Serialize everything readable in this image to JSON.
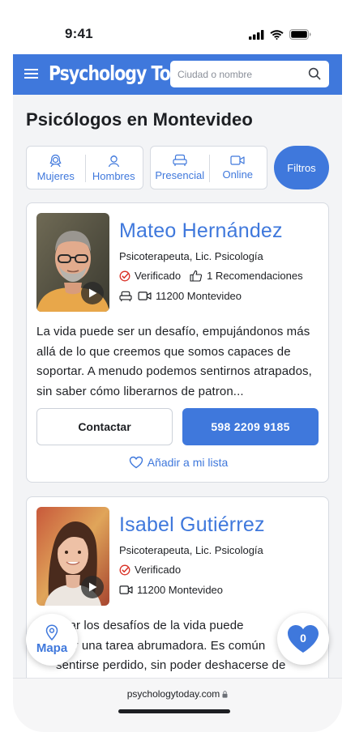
{
  "status_bar": {
    "time": "9:41"
  },
  "header": {
    "brand": "Psychology Today",
    "search_placeholder": "Ciudad o nombre"
  },
  "page": {
    "title": "Psicólogos en Montevideo"
  },
  "filters": {
    "gender": [
      {
        "label": "Mujeres",
        "icon": "woman-icon"
      },
      {
        "label": "Hombres",
        "icon": "man-icon"
      }
    ],
    "mode": [
      {
        "label": "Presencial",
        "icon": "armchair-icon"
      },
      {
        "label": "Online",
        "icon": "video-icon"
      }
    ],
    "filters_button": "Filtros"
  },
  "therapists": [
    {
      "name": "Mateo Hernández",
      "credentials": "Psicoterapeuta, Lic. Psicología",
      "verified": "Verificado",
      "recommendations": "1 Recomendaciones",
      "location": "11200 Montevideo",
      "bio": "La vida puede ser un desafío, empujándonos más allá de lo que creemos que somos capaces de soportar. A menudo podemos sentirnos atrapados, sin saber cómo liberarnos de patron...",
      "contact_label": "Contactar",
      "phone": "598 2209 9185",
      "add_to_list": "Añadir a mi lista"
    },
    {
      "name": "Isabel Gutiérrez",
      "credentials": "Psicoterapeuta, Lic. Psicología",
      "verified": "Verificado",
      "location": "11200 Montevideo",
      "bio_lines": [
        "Afrentar los desafíos de la vida puede",
        "parecer una tarea abrumadora. Es común",
        "sentirse perdido, sin poder deshacerse de"
      ]
    }
  ],
  "floating": {
    "map_label": "Mapa",
    "favorites_count": "0"
  },
  "browser": {
    "url": "psychologytoday.com"
  },
  "colors": {
    "brand_blue": "#3f78dc",
    "background": "#f3f4f6",
    "verified_red": "#d93025"
  }
}
